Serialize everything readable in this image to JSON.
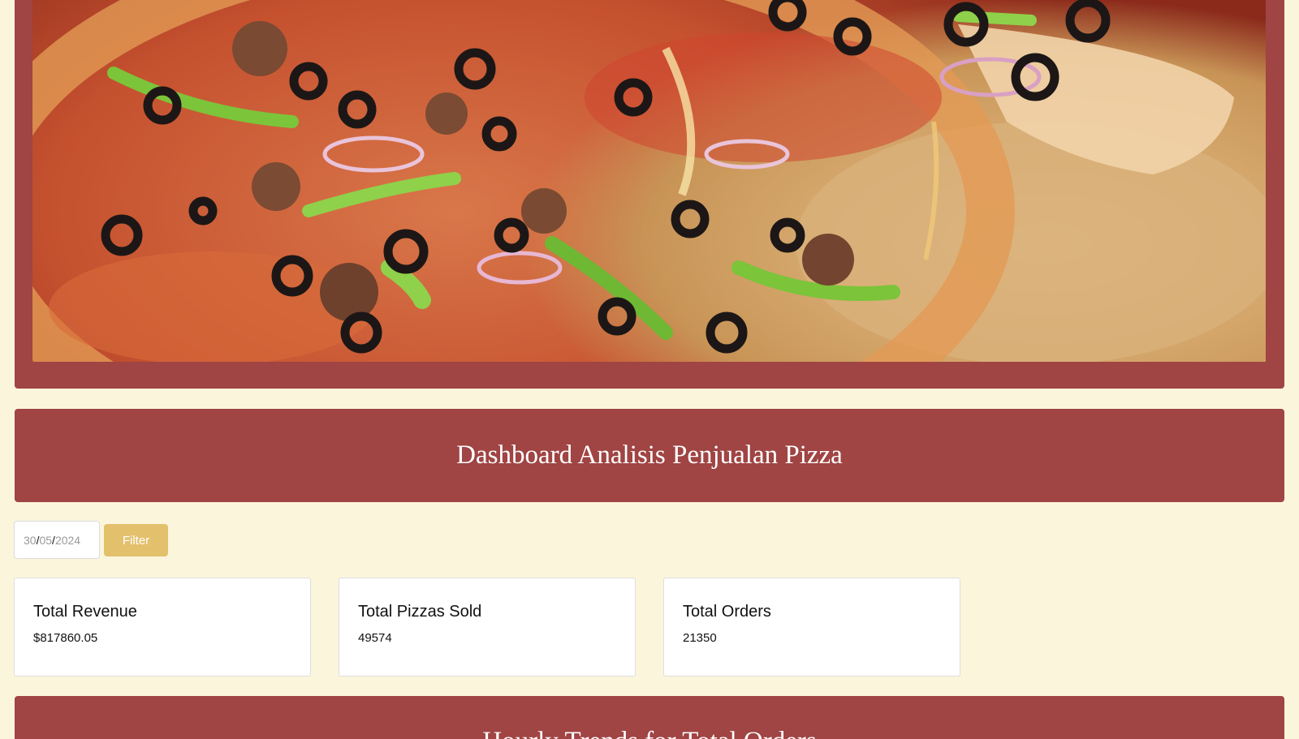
{
  "hero": {
    "image_alt": "pizza-photo"
  },
  "header": {
    "title": "Dashboard Analisis Penjualan Pizza"
  },
  "filter": {
    "date_day": "30",
    "date_month": "05",
    "date_year": "2024",
    "separator": "/",
    "button_label": "Filter"
  },
  "stats": [
    {
      "label": "Total Revenue",
      "value": "$817860.05"
    },
    {
      "label": "Total Pizzas Sold",
      "value": "49574"
    },
    {
      "label": "Total Orders",
      "value": "21350"
    }
  ],
  "next_section": {
    "title": "Hourly Trends for Total Orders"
  },
  "colors": {
    "background": "#fbf5dc",
    "brand_red": "#a04444",
    "accent_gold": "#e3c06c"
  }
}
